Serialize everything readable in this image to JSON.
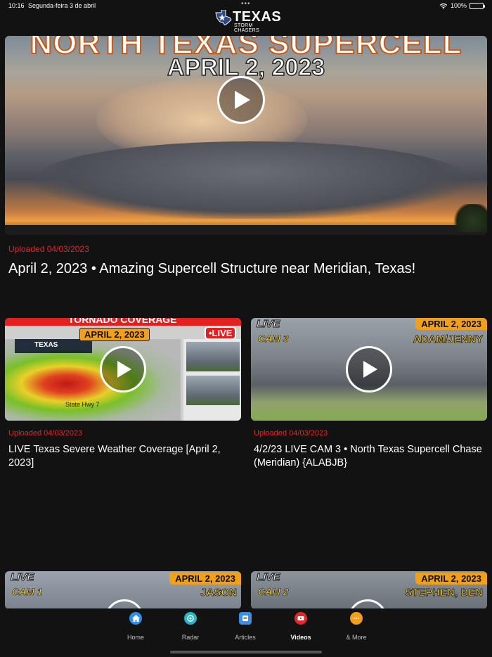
{
  "status_bar": {
    "time": "10:16",
    "date": "Segunda-feira 3 de abril",
    "battery": "100%"
  },
  "logo": {
    "word": "TEXAS",
    "sub": "STORM CHASERS"
  },
  "featured": {
    "overlay_title": "NORTH TEXAS SUPERCELL",
    "overlay_date": "APRIL 2, 2023",
    "uploaded": "Uploaded 04/03/2023",
    "title": "April 2, 2023 • Amazing Supercell Structure near Meridian, Texas!"
  },
  "videos": [
    {
      "overlay_banner": "TORNADO COVERAGE",
      "overlay_date": "APRIL 2, 2023",
      "overlay_live": "•LIVE",
      "overlay_logo": "TEXAS",
      "overlay_road": "State Hwy 7",
      "uploaded": "Uploaded 04/03/2023",
      "title": "LIVE Texas Severe Weather Coverage [April 2, 2023]"
    },
    {
      "overlay_live": "LIVE",
      "overlay_cam": "CAM 3",
      "overlay_date": "APRIL 2, 2023",
      "overlay_names": "ADAM/JENNY",
      "uploaded": "Uploaded 04/03/2023",
      "title": "4/2/23 LIVE CAM 3 • North Texas Supercell Chase (Meridian) {ALABJB}"
    },
    {
      "overlay_live": "LIVE",
      "overlay_cam": "CAM 1",
      "overlay_date": "APRIL 2, 2023",
      "overlay_names": "JASON"
    },
    {
      "overlay_live": "LIVE",
      "overlay_cam": "CAM 2",
      "overlay_date": "APRIL 2, 2023",
      "overlay_names": "STEPHEN, BEN"
    }
  ],
  "tabs": [
    {
      "label": "Home",
      "icon": "home-icon",
      "color": "#2f8fe8"
    },
    {
      "label": "Radar",
      "icon": "radar-icon",
      "color": "#2bb6c6"
    },
    {
      "label": "Articles",
      "icon": "articles-icon",
      "color": "#3a8ee6"
    },
    {
      "label": "Videos",
      "icon": "videos-icon",
      "color": "#e0292d",
      "active": true
    },
    {
      "label": "& More",
      "icon": "more-icon",
      "color": "#f2a01a"
    }
  ],
  "accent_color": "#e0292d"
}
